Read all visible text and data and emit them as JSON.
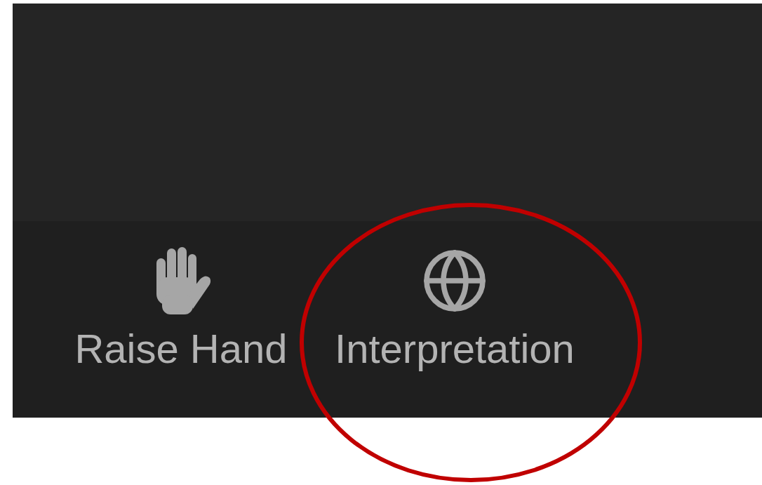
{
  "toolbar": {
    "buttons": [
      {
        "kind": "hand",
        "label": "Raise Hand",
        "highlighted": false
      },
      {
        "kind": "globe",
        "label": "Interpretation",
        "highlighted": true
      }
    ]
  }
}
